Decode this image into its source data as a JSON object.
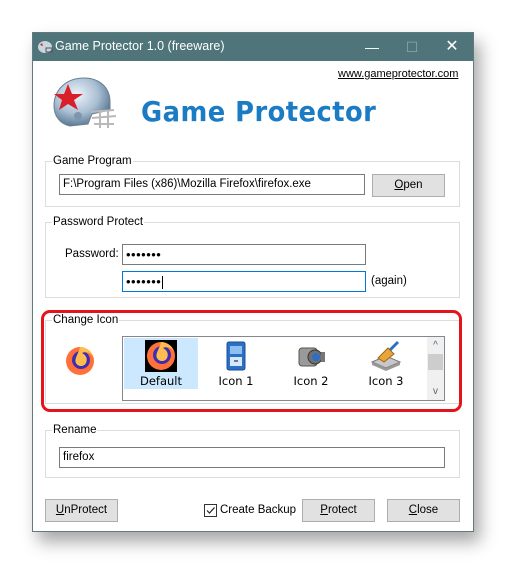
{
  "window": {
    "title": "Game Protector 1.0 (freeware)",
    "controls": {
      "minimize": "—",
      "maximize": "☐",
      "close": "✕"
    }
  },
  "header": {
    "website_link": "www.gameprotector.com",
    "logo_text": "Game Protector",
    "logo_icon": "football-helmet-icon",
    "brand_color": "#1b7cc4"
  },
  "game_program": {
    "legend": "Game Program",
    "path_value": "F:\\Program Files (x86)\\Mozilla Firefox\\firefox.exe",
    "open_button": {
      "accel": "O",
      "rest": "pen"
    }
  },
  "password_protect": {
    "legend": "Password Protect",
    "password_label": "Password:",
    "password_value": "•••••••",
    "confirm_value": "•••••••",
    "again_label": "(again)"
  },
  "change_icon": {
    "legend": "Change Icon",
    "current_icon": "firefox-icon",
    "highlight_color": "#e5141c",
    "items": [
      {
        "label": "Default",
        "icon": "firefox-icon",
        "selected": true
      },
      {
        "label": "Icon 1",
        "icon": "file-cabinet-icon",
        "selected": false
      },
      {
        "label": "Icon 2",
        "icon": "video-camera-icon",
        "selected": false
      },
      {
        "label": "Icon 3",
        "icon": "drive-broom-icon",
        "selected": false
      }
    ],
    "scroll_up": "^",
    "scroll_down": "v"
  },
  "rename": {
    "legend": "Rename",
    "value": "firefox"
  },
  "footer": {
    "unprotect_button": {
      "accel": "U",
      "rest": "nProtect"
    },
    "create_backup_label": "Create Backup",
    "create_backup_checked": true,
    "protect_button": {
      "accel": "P",
      "rest": "rotect"
    },
    "close_button": {
      "accel": "C",
      "rest": "lose"
    }
  }
}
